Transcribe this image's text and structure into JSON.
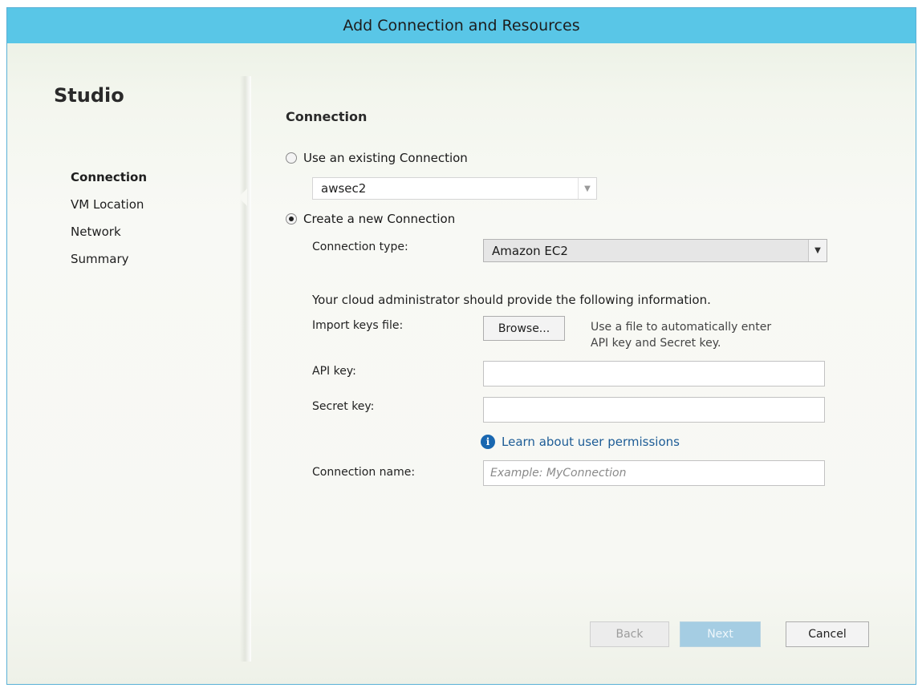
{
  "window": {
    "title": "Add Connection and Resources"
  },
  "sidebar": {
    "title": "Studio",
    "items": [
      {
        "label": "Connection",
        "active": true
      },
      {
        "label": "VM Location",
        "active": false
      },
      {
        "label": "Network",
        "active": false
      },
      {
        "label": "Summary",
        "active": false
      }
    ]
  },
  "main": {
    "section_title": "Connection",
    "existing": {
      "label": "Use an existing Connection",
      "selected": false,
      "dropdown_value": "awsec2"
    },
    "create_new": {
      "label": "Create a new Connection",
      "selected": true
    },
    "connection_type": {
      "label": "Connection type:",
      "value": "Amazon EC2"
    },
    "info_text": "Your cloud administrator should provide the following information.",
    "import_keys": {
      "label": "Import keys file:",
      "button_label": "Browse...",
      "hint_line1": "Use a file to automatically enter",
      "hint_line2": "API key and Secret key."
    },
    "api_key": {
      "label": "API key:",
      "value": ""
    },
    "secret_key": {
      "label": "Secret key:",
      "value": ""
    },
    "permissions_link": "Learn about user permissions",
    "connection_name": {
      "label": "Connection name:",
      "placeholder": "Example: MyConnection",
      "value": ""
    }
  },
  "footer": {
    "back_label": "Back",
    "next_label": "Next",
    "cancel_label": "Cancel"
  },
  "colors": {
    "titlebar": "#59c6e7",
    "link": "#1d5c96",
    "info_icon": "#1967b0",
    "next_disabled": "#a5cde3"
  },
  "icons": {
    "info": "info-icon",
    "dropdown": "chevron-down-icon"
  }
}
